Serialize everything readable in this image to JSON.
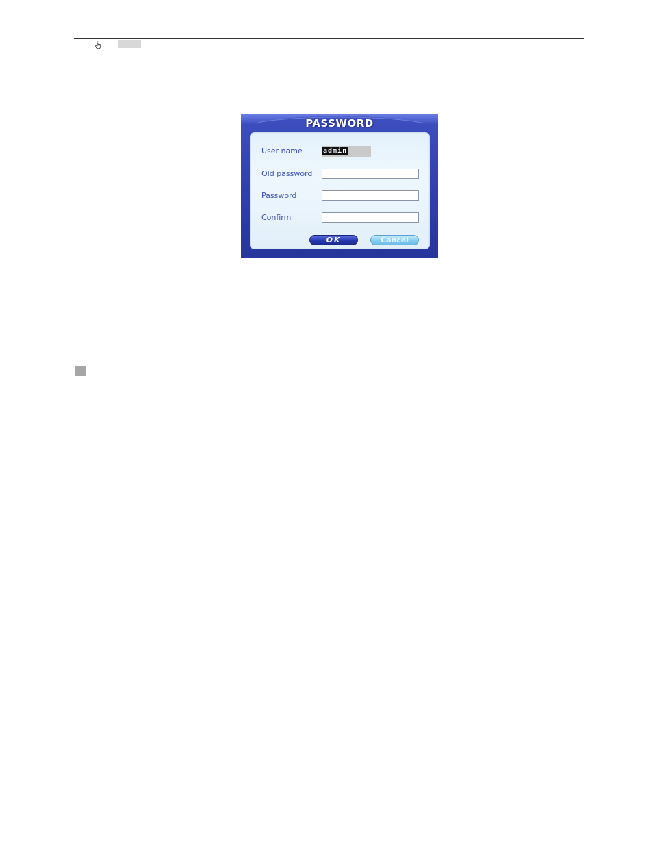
{
  "dialog": {
    "title": "PASSWORD",
    "fields": {
      "username": {
        "label": "User name",
        "value": "admin"
      },
      "old_password": {
        "label": "Old password",
        "value": ""
      },
      "password": {
        "label": "Password",
        "value": ""
      },
      "confirm": {
        "label": "Confirm",
        "value": ""
      }
    },
    "buttons": {
      "ok": "OK",
      "cancel": "Cancel"
    }
  },
  "colors": {
    "frame": "#2f3fae",
    "panel": "#e8f3fc",
    "label": "#3c4fb8",
    "ok_button": "#2839b0",
    "cancel_button": "#87cdf0"
  },
  "icons": {
    "header": "hand-pointer-icon"
  }
}
